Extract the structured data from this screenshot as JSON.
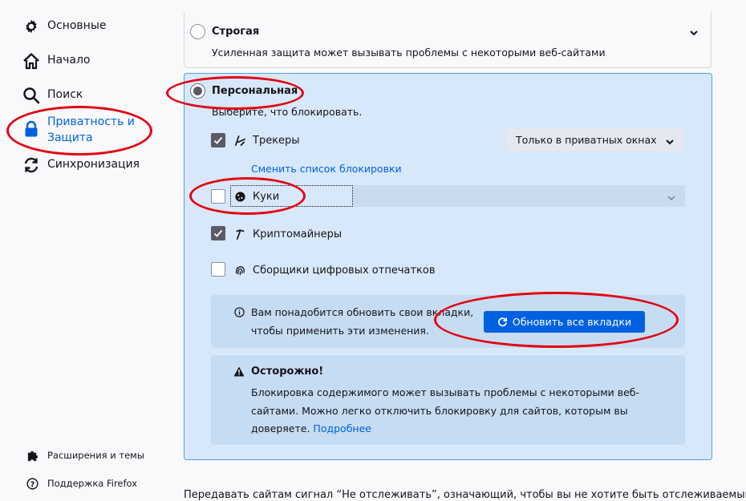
{
  "sidebar": {
    "items": [
      {
        "label": "Основные",
        "icon": "gear-icon"
      },
      {
        "label": "Начало",
        "icon": "home-icon"
      },
      {
        "label": "Поиск",
        "icon": "search-icon"
      },
      {
        "label": "Приватность и\nЗащита",
        "icon": "lock-icon",
        "selected": true
      },
      {
        "label": "Синхронизация",
        "icon": "sync-icon"
      }
    ],
    "footer": [
      {
        "label": "Расширения и темы",
        "icon": "puzzle-icon"
      },
      {
        "label": "Поддержка Firefox",
        "icon": "help-icon"
      }
    ]
  },
  "strict": {
    "title": "Строгая",
    "description": "Усиленная защита может вызывать проблемы с некоторыми веб-сайтами"
  },
  "custom": {
    "title": "Персональная",
    "subtitle": "Выберите, что блокировать.",
    "trackers": {
      "label": "Трекеры",
      "checked": true,
      "select_value": "Только в приватных окнах",
      "link": "Сменить список блокировки"
    },
    "cookies": {
      "label": "Куки",
      "checked": false
    },
    "cryptominers": {
      "label": "Криптомайнеры",
      "checked": true
    },
    "fingerprinters": {
      "label": "Сборщики цифровых отпечатков",
      "checked": false
    }
  },
  "reload_notice": {
    "line1": "Вам понадобится обновить свои вкладки,",
    "line2": "чтобы применить эти изменения.",
    "button": "Обновить все вкладки"
  },
  "warning": {
    "title": "Осторожно!",
    "line1": "Блокировка содержимого может вызывать проблемы с некоторыми веб-",
    "line2": "сайтами. Можно легко отключить блокировку для сайтов, которым вы",
    "line3": "доверяете.",
    "link": "Подробнее"
  },
  "dnt_text": "Передавать сайтам сигнал “Не отслеживать”, означающий, чтобы вы не хотите быть отслеживаемыми",
  "colors": {
    "accent": "#0061e0",
    "annotation": "#e3000f",
    "custom_panel": "#d7e8fa"
  }
}
